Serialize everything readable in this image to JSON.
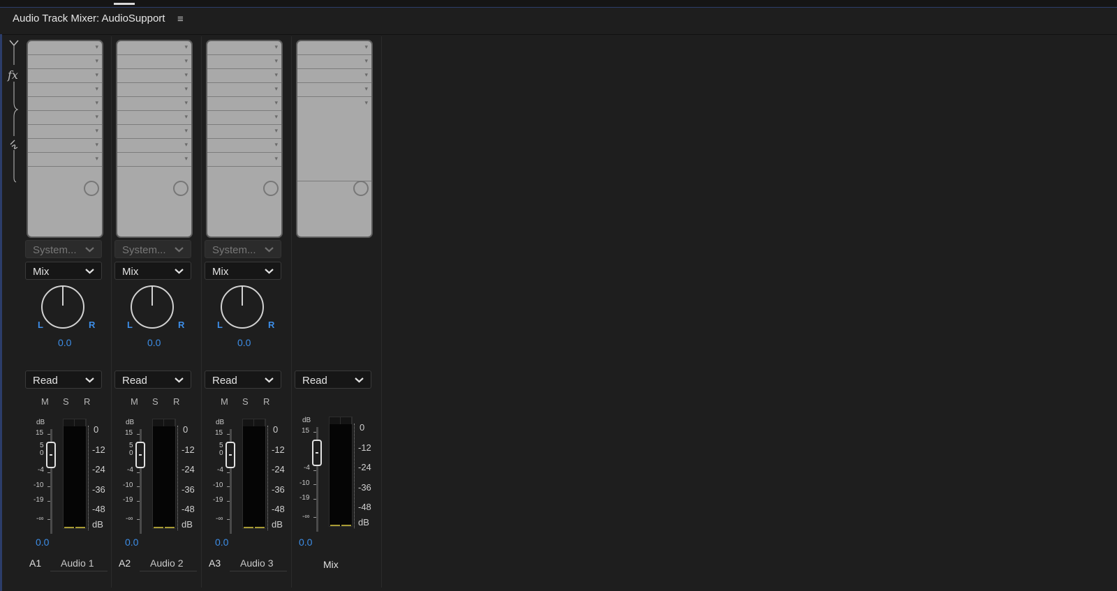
{
  "panel": {
    "title": "Audio Track Mixer: AudioSupport",
    "menu_icon": "hamburger-menu-icon"
  },
  "rail": {
    "icons": [
      "input-icon",
      "fx-icon",
      "sends-icon"
    ],
    "fx_label": "fx"
  },
  "strips": [
    {
      "id": "A1",
      "name": "Audio 1",
      "input": "System...",
      "output": "Mix",
      "pan_l": "L",
      "pan_r": "R",
      "pan_value": "0.0",
      "automation": "Read",
      "mute": "M",
      "solo": "S",
      "record": "R",
      "volume": "0.0"
    },
    {
      "id": "A2",
      "name": "Audio 2",
      "input": "System...",
      "output": "Mix",
      "pan_l": "L",
      "pan_r": "R",
      "pan_value": "0.0",
      "automation": "Read",
      "mute": "M",
      "solo": "S",
      "record": "R",
      "volume": "0.0"
    },
    {
      "id": "A3",
      "name": "Audio 3",
      "input": "System...",
      "output": "Mix",
      "pan_l": "L",
      "pan_r": "R",
      "pan_value": "0.0",
      "automation": "Read",
      "mute": "M",
      "solo": "S",
      "record": "R",
      "volume": "0.0"
    }
  ],
  "master": {
    "name": "Mix",
    "automation": "Read",
    "volume": "0.0"
  },
  "fader_scale": {
    "unit": "dB",
    "l15": "15",
    "l5": "5",
    "l0": "0",
    "lm4": "-4",
    "lm10": "-10",
    "lm19": "-19",
    "linf": "-∞"
  },
  "meter_scale": {
    "m0": "0",
    "m12": "-12",
    "m24": "-24",
    "m36": "-36",
    "m48": "-48",
    "unit": "dB"
  },
  "colors": {
    "accent_blue": "#3d8ee8",
    "background": "#1e1e1e",
    "rack_gray": "#a9a9a9"
  }
}
